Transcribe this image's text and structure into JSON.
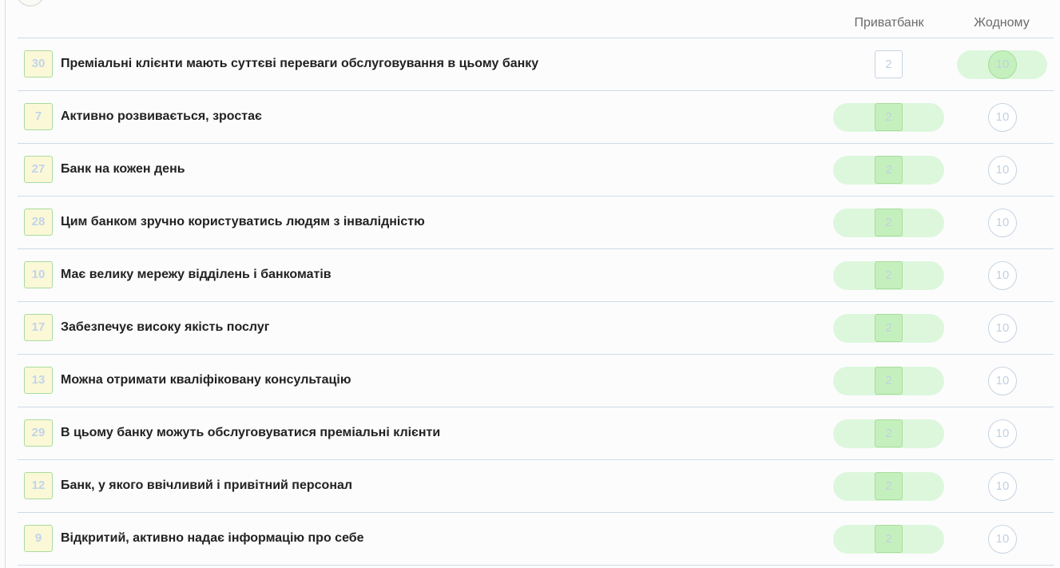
{
  "columns": {
    "col1": "Приватбанк",
    "col2": "Жодному"
  },
  "rows": [
    {
      "num": "30",
      "text": "Преміальні клієнти мають суттєві переваги обслуговування в цьому банку",
      "val1": "2",
      "val2": "10",
      "selected": "col2"
    },
    {
      "num": "7",
      "text": "Активно розвивається, зростає",
      "val1": "2",
      "val2": "10",
      "selected": "col1"
    },
    {
      "num": "27",
      "text": "Банк на кожен день",
      "val1": "2",
      "val2": "10",
      "selected": "col1"
    },
    {
      "num": "28",
      "text": "Цим банком зручно користуватись людям з інвалідністю",
      "val1": "2",
      "val2": "10",
      "selected": "col1"
    },
    {
      "num": "10",
      "text": "Має велику мережу відділень і банкоматів",
      "val1": "2",
      "val2": "10",
      "selected": "col1"
    },
    {
      "num": "17",
      "text": "Забезпечує високу якість послуг",
      "val1": "2",
      "val2": "10",
      "selected": "col1"
    },
    {
      "num": "13",
      "text": "Можна отримати кваліфіковану консультацію",
      "val1": "2",
      "val2": "10",
      "selected": "col1"
    },
    {
      "num": "29",
      "text": "В цьому банку можуть обслуговуватися преміальні клієнти",
      "val1": "2",
      "val2": "10",
      "selected": "col1"
    },
    {
      "num": "12",
      "text": "Банк, у якого ввічливий і привітний персонал",
      "val1": "2",
      "val2": "10",
      "selected": "col1"
    },
    {
      "num": "9",
      "text": "Відкритий, активно надає інформацію про себе",
      "val1": "2",
      "val2": "10",
      "selected": "col1"
    }
  ]
}
